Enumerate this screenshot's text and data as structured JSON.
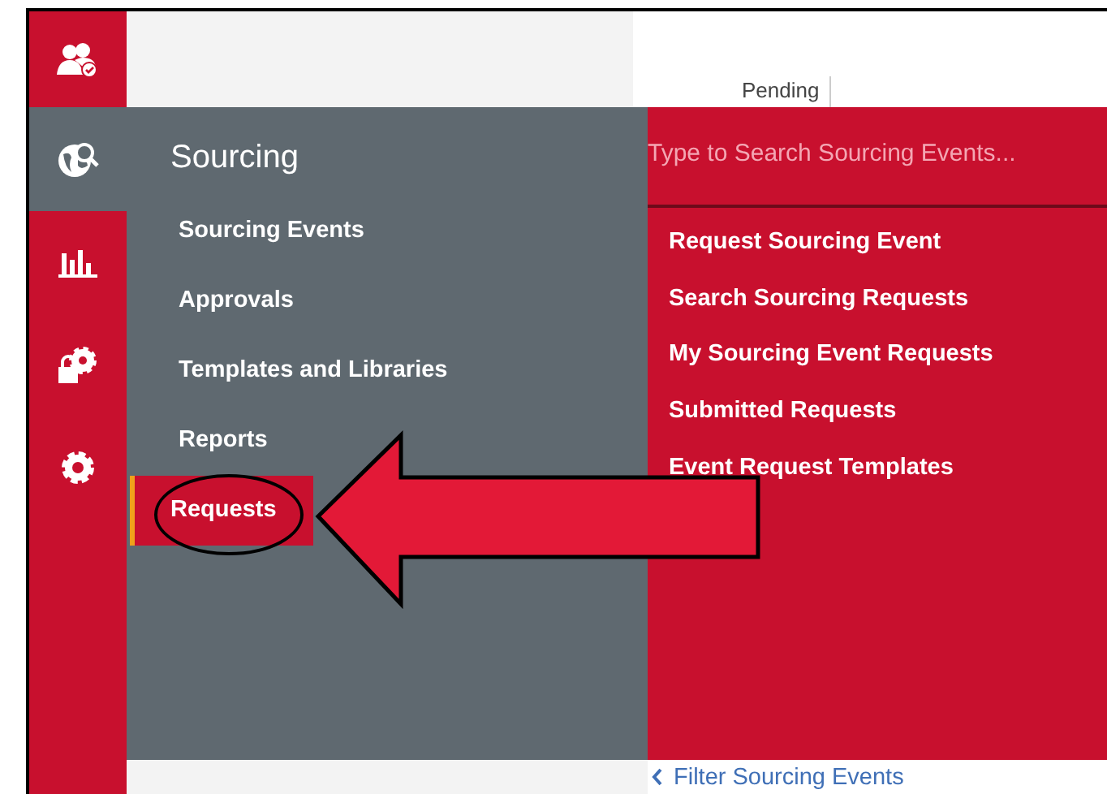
{
  "rail": [
    {
      "kind": "people",
      "selected": false
    },
    {
      "kind": "globe",
      "selected": true
    },
    {
      "kind": "chart",
      "selected": false
    },
    {
      "kind": "lock",
      "selected": false
    },
    {
      "kind": "gear",
      "selected": false
    }
  ],
  "top_tab": {
    "label": "Pending"
  },
  "menu": {
    "title": "Sourcing",
    "items": [
      {
        "label": "Sourcing Events",
        "selected": false
      },
      {
        "label": "Approvals",
        "selected": false
      },
      {
        "label": "Templates and Libraries",
        "selected": false
      },
      {
        "label": "Reports",
        "selected": false
      },
      {
        "label": "Requests",
        "selected": true
      }
    ]
  },
  "submenu": {
    "search": {
      "placeholder": "Type to Search Sourcing Events..."
    },
    "items": [
      "Request Sourcing Event",
      "Search Sourcing Requests",
      "My Sourcing Event Requests",
      "Submitted Requests",
      "Event Request Templates"
    ]
  },
  "filter_link": {
    "label": "Filter Sourcing Events"
  }
}
